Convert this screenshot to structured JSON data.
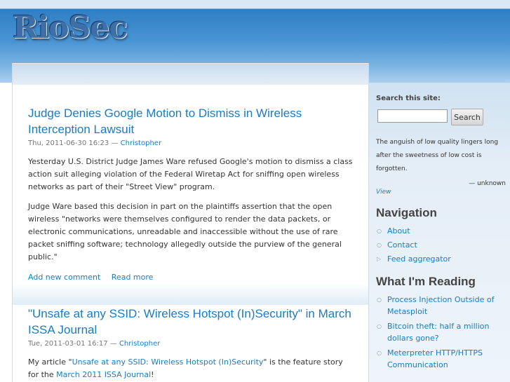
{
  "site": {
    "logo": "RioSec"
  },
  "posts": [
    {
      "title": "Judge Denies Google Motion to Dismiss in Wireless Interception Lawsuit",
      "date": "Thu, 2011-06-30 16:23",
      "author": "Christopher",
      "paragraphs": [
        "Yesterday U.S. District Judge James Ware refused Google's motion to dismiss a class action suit alleging violation of the Federal Wiretap Act for sniffing open wireless networks as part of their \"Street View\" program.",
        "Judge Ware based this decision in part on the plaintiffs assertion that the open wireless \"networks were themselves configured to render the data packets, or electronic communications, unreadable and inaccessible without the use of rare packet sniffing software; technology allegedly outside the purview of the general public.\""
      ],
      "links": [
        "Add new comment",
        "Read more"
      ]
    },
    {
      "title": "\"Unsafe at any SSID: Wireless Hotspot (In)Security\" in March ISSA Journal",
      "date": "Tue, 2011-03-01 16:17",
      "author": "Christopher",
      "p_prefix": "My article \"",
      "p_link1": "Unsafe at any SSID: Wireless Hotspot (In)Security",
      "p_middle": "\" is the feature story for the ",
      "p_link2": "March 2011 ISSA Journal",
      "p_suffix": "!"
    }
  ],
  "sidebar": {
    "search": {
      "label": "Search this site:",
      "value": "",
      "button": "Search"
    },
    "quote": {
      "text": "The anguish of low quality lingers long after the sweetness of low cost is forgotten.",
      "author": "— unknown",
      "view": "View"
    },
    "navigation": {
      "title": "Navigation",
      "items": [
        "About",
        "Contact",
        "Feed aggregator"
      ]
    },
    "reading": {
      "title": "What I'm Reading",
      "items": [
        "Process Injection Outside of Metasploit",
        "Bitcoin theft: half a million dollars gone?",
        "Meterpreter HTTP/HTTPS Communication"
      ]
    }
  }
}
